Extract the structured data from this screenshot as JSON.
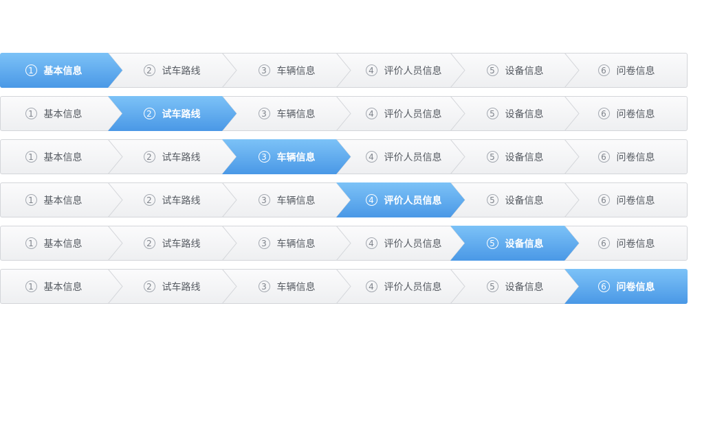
{
  "steps": [
    {
      "num": "1",
      "label": "基本信息"
    },
    {
      "num": "2",
      "label": "试车路线"
    },
    {
      "num": "3",
      "label": "车辆信息"
    },
    {
      "num": "4",
      "label": "评价人员信息"
    },
    {
      "num": "5",
      "label": "设备信息"
    },
    {
      "num": "6",
      "label": "问卷信息"
    }
  ],
  "wizards": [
    {
      "active_step": 1
    },
    {
      "active_step": 2
    },
    {
      "active_step": 3
    },
    {
      "active_step": 4
    },
    {
      "active_step": 5
    },
    {
      "active_step": 6
    }
  ],
  "colors": {
    "active_top": "#7cc2f7",
    "active_bottom": "#4a98e6",
    "inactive_top": "#fbfbfc",
    "inactive_bottom": "#eeeff1",
    "border": "#d3d5d9",
    "chevron": "#d5d7db",
    "text": "#555a61",
    "number": "#7d828a"
  }
}
